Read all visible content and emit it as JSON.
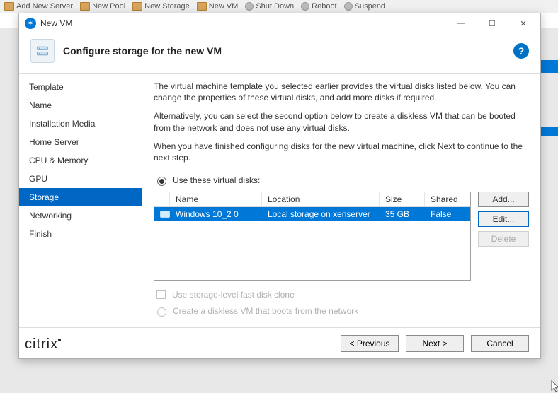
{
  "bg_toolbar": {
    "items": [
      "Add New Server",
      "New Pool",
      "New Storage",
      "New VM",
      "Shut Down",
      "Reboot",
      "Suspend"
    ]
  },
  "window": {
    "title": "New VM",
    "help_tooltip": "?",
    "buttons": {
      "minimize": "—",
      "maximize": "☐",
      "close": "✕"
    }
  },
  "header": {
    "title": "Configure storage for the new VM"
  },
  "sidebar": {
    "items": [
      {
        "label": "Template"
      },
      {
        "label": "Name"
      },
      {
        "label": "Installation Media"
      },
      {
        "label": "Home Server"
      },
      {
        "label": "CPU & Memory"
      },
      {
        "label": "GPU"
      },
      {
        "label": "Storage",
        "active": true
      },
      {
        "label": "Networking"
      },
      {
        "label": "Finish"
      }
    ]
  },
  "content": {
    "p1": "The virtual machine template you selected earlier provides the virtual disks listed below. You can change the properties of these virtual disks, and add more disks if required.",
    "p2": "Alternatively, you can select the second option below to create a diskless VM that can be booted from the network and does not use any virtual disks.",
    "p3": "When you have finished configuring disks for the new virtual machine, click Next to continue to the next step.",
    "radio_use": "Use these virtual disks:",
    "clone_label": "Use storage-level fast disk clone",
    "radio_diskless": "Create a diskless VM that boots from the network",
    "table": {
      "cols": {
        "name": "Name",
        "location": "Location",
        "size": "Size",
        "shared": "Shared"
      },
      "rows": [
        {
          "name": "Windows 10_2 0",
          "location": "Local storage on xenserver",
          "size": "35 GB",
          "shared": "False"
        }
      ]
    },
    "side_buttons": {
      "add": "Add...",
      "edit": "Edit...",
      "delete": "Delete"
    }
  },
  "footer": {
    "prev": "< Previous",
    "next": "Next >",
    "cancel": "Cancel"
  },
  "brand": "citrix"
}
